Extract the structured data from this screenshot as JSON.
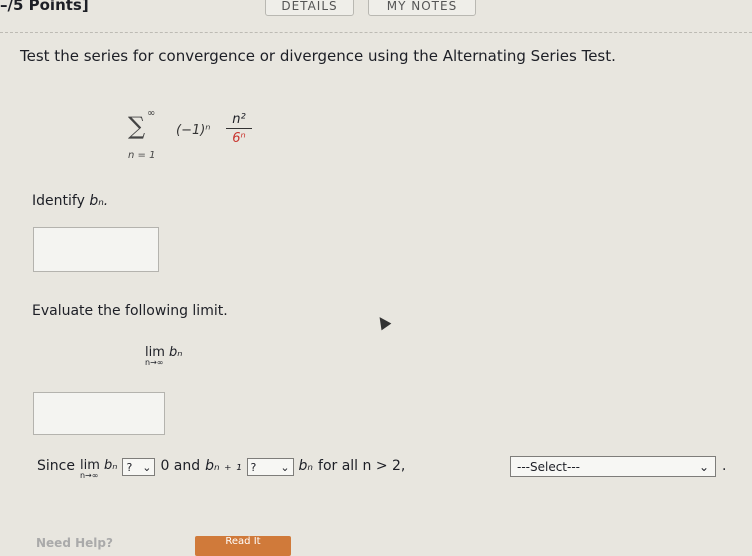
{
  "header": {
    "points": "–/5 Points]",
    "details_button": "DETAILS",
    "my_notes_button": "MY NOTES"
  },
  "question": {
    "prompt": "Test the series for convergence or divergence using the Alternating Series Test.",
    "series": {
      "sigma": "∑",
      "upper": "∞",
      "lower": "n = 1",
      "term": "(−1)ⁿ",
      "numerator": "n²",
      "denominator": "6ⁿ"
    },
    "identify_label": "Identify",
    "identify_var": "bₙ.",
    "evaluate_label": "Evaluate the following limit.",
    "limit_text": "lim",
    "limit_sub": "n→∞",
    "limit_var": "bₙ",
    "since": {
      "since_label": "Since",
      "lim_text": "lim",
      "lim_sub": "n→∞",
      "lim_var": "bₙ",
      "select1_value": "?",
      "zero_text": "0 and",
      "bn1": "bₙ ₊ ₁",
      "select2_value": "?",
      "bn": "bₙ",
      "for_all": "for all n > 2,",
      "select3_value": "---Select---",
      "period": "."
    }
  },
  "footer": {
    "need_help": "Need Help?",
    "read_it": "Read It"
  },
  "icons": {
    "chevron": "⌄"
  }
}
